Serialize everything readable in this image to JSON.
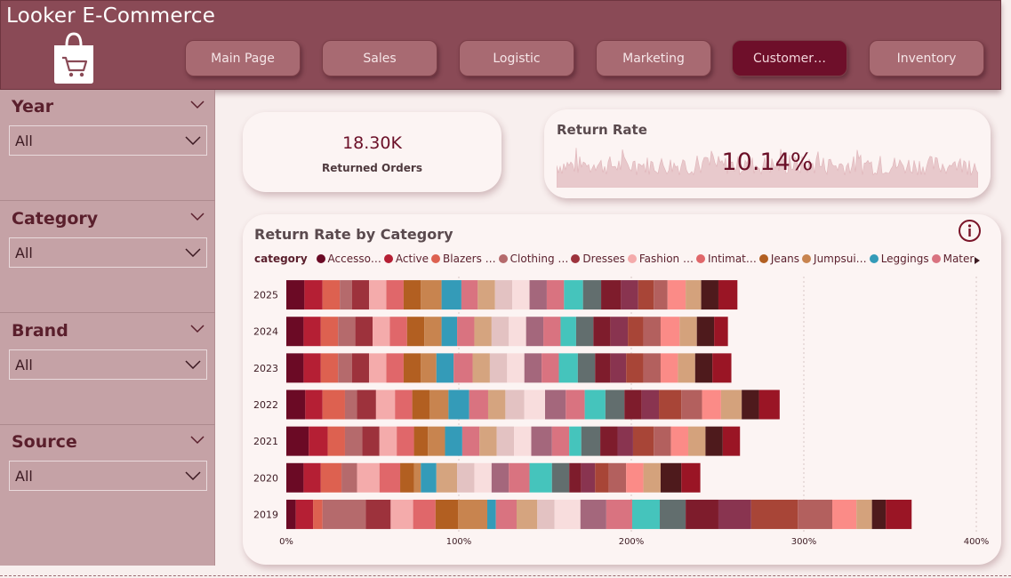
{
  "header": {
    "title": "Looker E-Commerce",
    "logo_icon": "shopping-bag-cart-icon",
    "nav": [
      {
        "label": "Main Page",
        "active": false
      },
      {
        "label": "Sales",
        "active": false
      },
      {
        "label": "Logistic",
        "active": false
      },
      {
        "label": "Marketing",
        "active": false
      },
      {
        "label": "Customer…",
        "active": true
      },
      {
        "label": "Inventory",
        "active": false
      }
    ]
  },
  "filters": [
    {
      "label": "Year",
      "value": "All"
    },
    {
      "label": "Category",
      "value": "All"
    },
    {
      "label": "Brand",
      "value": "All"
    },
    {
      "label": "Source",
      "value": "All"
    }
  ],
  "kpi": {
    "value": "18.30K",
    "label": "Returned Orders"
  },
  "return_rate": {
    "title": "Return Rate",
    "value": "10.14%"
  },
  "chart_data": {
    "type": "bar",
    "orientation": "horizontal",
    "stacked": true,
    "title": "Return Rate by Category",
    "legend_title": "category",
    "legend": [
      {
        "label": "Accesso…",
        "color": "#6b0a25"
      },
      {
        "label": "Active",
        "color": "#b51f34"
      },
      {
        "label": "Blazers …",
        "color": "#dd6150"
      },
      {
        "label": "Clothing …",
        "color": "#b56a6c"
      },
      {
        "label": "Dresses",
        "color": "#9d323c"
      },
      {
        "label": "Fashion …",
        "color": "#f4abab"
      },
      {
        "label": "Intimat…",
        "color": "#e0676a"
      },
      {
        "label": "Jeans",
        "color": "#b25f21"
      },
      {
        "label": "Jumpsui…",
        "color": "#c8844f"
      },
      {
        "label": "Leggings",
        "color": "#349bb8"
      },
      {
        "label": "Maternity",
        "color": "#d97380"
      }
    ],
    "categories": [
      "2025",
      "2024",
      "2023",
      "2022",
      "2021",
      "2020",
      "2019"
    ],
    "x_ticks": [
      "0%",
      "100%",
      "200%",
      "300%",
      "400%"
    ],
    "xlim": [
      0,
      400
    ],
    "segment_colors": [
      "#6b0a25",
      "#b51f34",
      "#dd6150",
      "#b56a6c",
      "#9d323c",
      "#f4abab",
      "#e0676a",
      "#b25f21",
      "#c8844f",
      "#349bb8",
      "#d97380",
      "#d5a47f",
      "#e3c2c2",
      "#f8dddd",
      "#a4677c",
      "#d97380",
      "#45c4bc",
      "#626e6e",
      "#7e1c2c",
      "#893450",
      "#a84537",
      "#b3605e",
      "#fb8b87",
      "#d4a27c",
      "#4e1a1c",
      "#9a1525"
    ],
    "rows": [
      [
        10.5,
        10.5,
        10,
        7,
        10,
        10,
        10,
        10,
        12,
        11.5,
        9.5,
        10,
        10,
        10,
        10,
        10,
        11,
        10.5,
        11.5,
        10,
        9,
        8,
        10.5,
        9,
        10,
        11
      ],
      [
        10,
        10,
        10,
        10,
        10,
        10,
        10,
        10,
        10,
        9,
        10,
        10,
        10,
        10,
        10,
        10,
        9,
        10,
        10,
        10,
        9,
        10,
        11,
        10,
        10,
        8
      ],
      [
        10,
        10,
        10,
        8,
        10,
        10,
        10,
        10,
        9,
        10,
        11,
        10,
        10,
        10,
        10,
        10,
        11,
        10,
        9,
        9,
        10,
        10,
        10,
        10,
        10,
        11
      ],
      [
        11,
        10,
        13,
        7,
        11,
        11,
        10,
        10,
        11,
        12,
        11,
        10,
        11,
        12,
        12,
        11,
        12,
        11,
        10,
        10,
        13,
        12,
        11,
        12,
        10,
        12
      ],
      [
        13,
        11,
        10,
        10,
        10,
        10,
        10,
        8,
        10,
        10,
        10,
        10,
        10,
        10,
        12,
        10,
        7,
        11,
        10,
        9,
        12,
        10,
        10,
        10,
        10,
        10
      ],
      [
        10,
        10,
        12,
        9,
        0,
        13,
        12,
        8,
        4,
        9,
        0,
        12,
        10,
        10,
        10,
        12,
        13,
        10,
        7,
        8,
        8,
        10,
        10,
        10,
        12,
        11
      ],
      [
        5.5,
        10,
        5.5,
        25,
        14.5,
        13,
        13,
        13,
        17,
        5,
        12,
        12,
        10,
        15,
        15,
        15,
        16,
        15,
        19,
        19,
        27,
        20,
        14,
        9,
        8,
        15
      ]
    ]
  }
}
